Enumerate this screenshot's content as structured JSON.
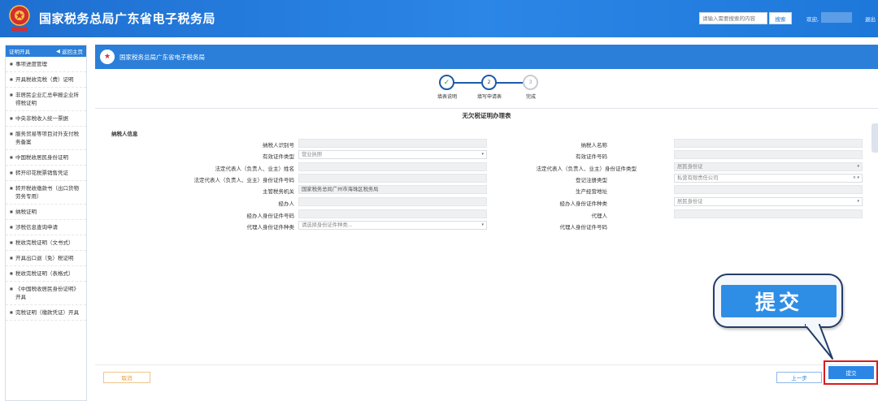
{
  "header": {
    "site_title": "国家税务总局广东省电子税务局",
    "search_placeholder": "请输入需要搜索的内容",
    "search_button": "搜索",
    "welcome": "欢迎,",
    "logout": "退出"
  },
  "sidebar": {
    "title": "证明开具",
    "back_label": "返回主页",
    "items": [
      "事项进度管理",
      "开具税收完税（费）证明",
      "非居民企业汇总申报企业所得税证明",
      "中央非税收入统一票据",
      "服务贸易等项目对外支付税务备案",
      "中国税收居民身份证明",
      "转开印花税票销售凭证",
      "转开税收缴款书（出口货物劳务专用）",
      "纳税证明",
      "涉税信息查询申请",
      "税收完税证明（文书式）",
      "开具出口退（免）税证明",
      "税收完税证明（表格式）",
      "《中国税收居民身份证明》开具",
      "完税证明（缴款凭证）开具"
    ]
  },
  "main": {
    "title_bar": "国家税务总局广东省电子税务局",
    "steps": [
      {
        "num": "✓",
        "label": "填表说明"
      },
      {
        "num": "2",
        "label": "填写申请表"
      },
      {
        "num": "3",
        "label": "完成"
      }
    ],
    "form_title": "无欠税证明办理表",
    "section_title": "纳税人信息",
    "fields": {
      "taxpayer_id_label": "纳税人识别号",
      "taxpayer_name_label": "纳税人名称",
      "cert_type_label": "有效证件类型",
      "cert_type_value": "营业执照",
      "cert_no_label": "有效证件号码",
      "legal_name_label": "法定代表人（负责人、业主）姓名",
      "legal_id_type_label": "法定代表人（负责人、业主）身份证件类型",
      "legal_id_type_value": "居民身份证",
      "legal_id_no_label": "法定代表人（负责人、业主）身份证件号码",
      "reg_type_label": "登记注册类型",
      "reg_type_value": "私营有限责任公司",
      "tax_office_label": "主管税务机关",
      "tax_office_value": "国家税务总局广州市海珠区税务局",
      "address_label": "生产经营地址",
      "agent_label": "经办人",
      "agent_id_type_label": "经办人身份证件种类",
      "agent_id_type_value": "居民身份证",
      "agent_id_no_label": "经办人身份证件号码",
      "proxy_label": "代理人",
      "proxy_id_type_label": "代理人身份证件种类",
      "proxy_id_type_placeholder": "请选择身份证件种类...",
      "proxy_id_no_label": "代理人身份证件号码"
    },
    "buttons": {
      "cancel": "取消",
      "prev": "上一步",
      "submit": "提交"
    }
  },
  "callout": {
    "text": "提交"
  },
  "colors": {
    "header_blue": "#2b86e6",
    "panel_blue": "#2b7fd9",
    "highlight_red": "#d81d1d",
    "callout_border": "#233d69"
  }
}
